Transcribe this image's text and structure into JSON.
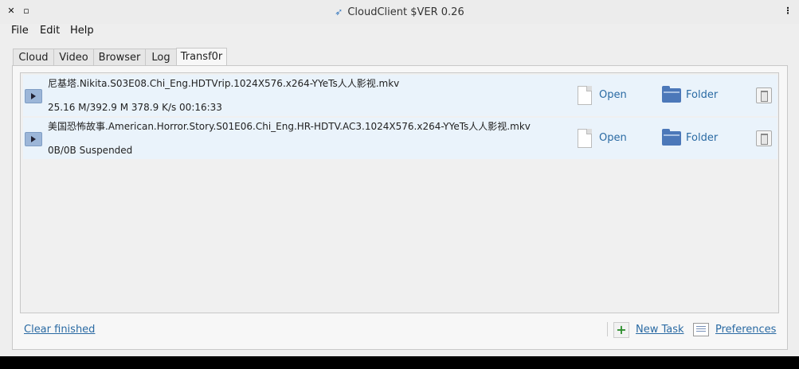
{
  "window": {
    "title": "CloudClient $VER 0.26",
    "close_glyph": "✕",
    "maximize_glyph": "▫",
    "menu_glyph": "⋮"
  },
  "menubar": [
    "File",
    "Edit",
    "Help"
  ],
  "tabs": [
    {
      "label": "Cloud",
      "active": false
    },
    {
      "label": "Video",
      "active": false
    },
    {
      "label": "Browser",
      "active": false
    },
    {
      "label": "Log",
      "active": false
    },
    {
      "label": "Transf0r",
      "active": true
    }
  ],
  "transfers": [
    {
      "filename": "尼基塔.Nikita.S03E08.Chi_Eng.HDTVrip.1024X576.x264-YYeTs人人影视.mkv",
      "status": "25.16 M/392.9 M  378.9 K/s  00:16:33",
      "open_label": "Open",
      "folder_label": "Folder"
    },
    {
      "filename": "美国恐怖故事.American.Horror.Story.S01E06.Chi_Eng.HR-HDTV.AC3.1024X576.x264-YYeTs人人影视.mkv",
      "status": "0B/0B Suspended",
      "open_label": "Open",
      "folder_label": "Folder"
    }
  ],
  "footer": {
    "clear_finished": "Clear finished",
    "new_task": "New Task",
    "preferences": "Preferences"
  }
}
